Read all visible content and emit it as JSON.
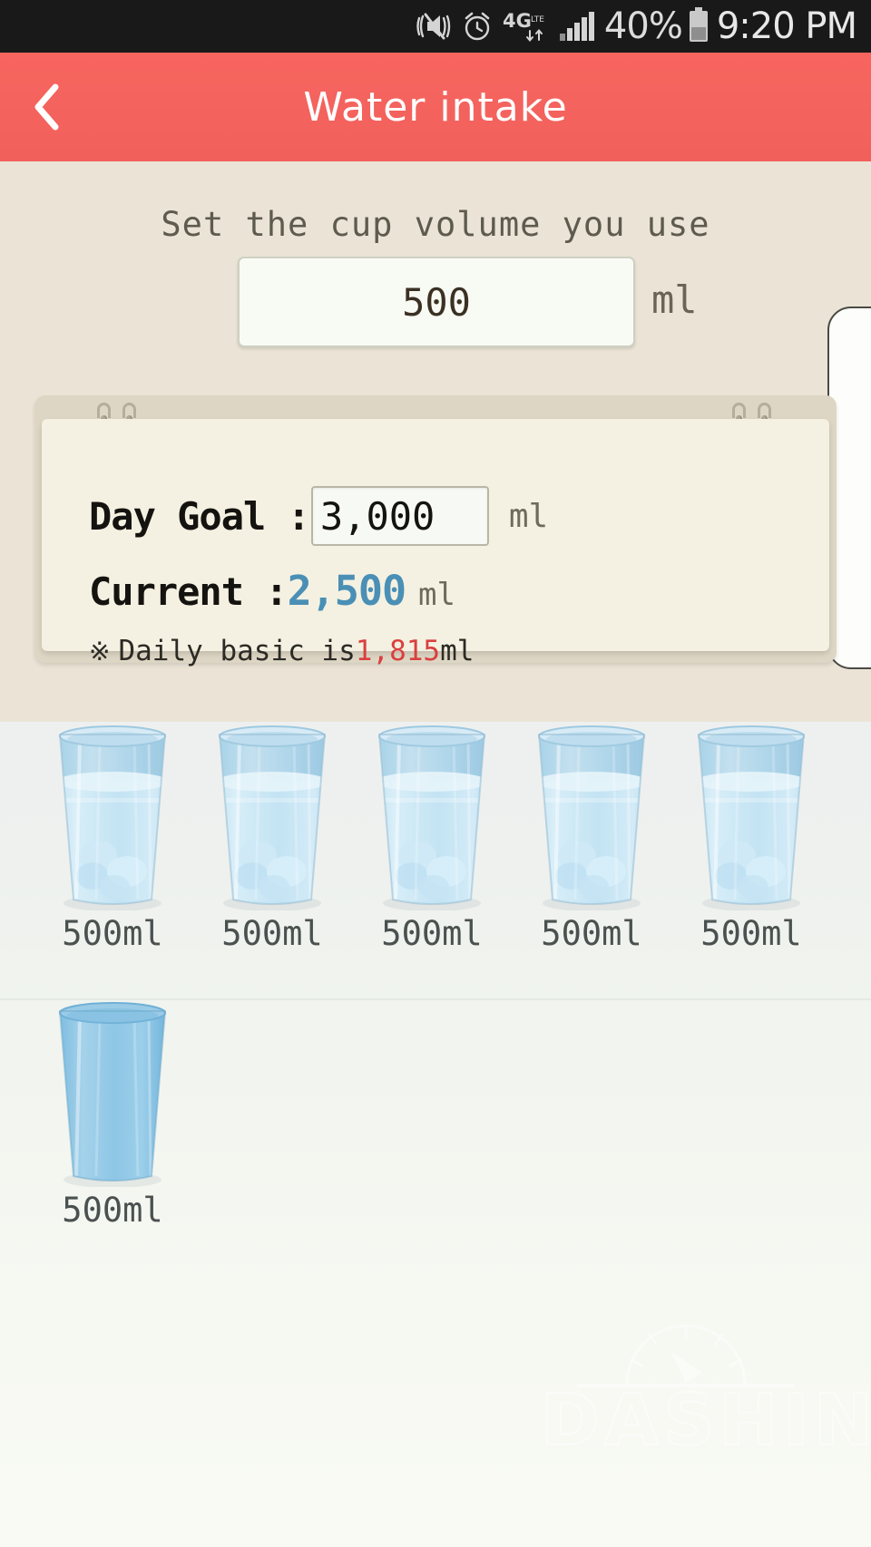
{
  "statusbar": {
    "icons": [
      "vibrate-mute-icon",
      "alarm-clock-icon",
      "4g-lte-icon",
      "signal-bars-icon"
    ],
    "network_label": "4G",
    "network_sub": "LTE",
    "battery_percent": "40%",
    "time": "9:20 PM"
  },
  "header": {
    "back_icon": "chevron-left-icon",
    "title": "Water intake",
    "color": "#f4635e"
  },
  "settings": {
    "prompt": "Set the cup volume you use",
    "cup_volume_value": "500",
    "cup_volume_placeholder": "500",
    "cup_volume_unit": "ml"
  },
  "goal_card": {
    "day_goal_label": "Day Goal :",
    "day_goal_value": "3,000",
    "day_goal_placeholder": "3,000",
    "day_goal_unit": "ml",
    "current_label": "Current :",
    "current_value": "2,500",
    "current_unit": "ml",
    "current_color": "#4a8fb5",
    "basic_star": "※",
    "basic_text": "Daily basic is",
    "basic_value": "1,815",
    "basic_unit": "ml",
    "basic_value_color": "#d9403f"
  },
  "glasses": {
    "row1": [
      {
        "label": "500ml",
        "state": "filled"
      },
      {
        "label": "500ml",
        "state": "filled"
      },
      {
        "label": "500ml",
        "state": "filled"
      },
      {
        "label": "500ml",
        "state": "filled"
      },
      {
        "label": "500ml",
        "state": "filled"
      }
    ],
    "row2": [
      {
        "label": "500ml",
        "state": "empty"
      }
    ]
  },
  "watermark": {
    "text": "DASHIN",
    "icon": "gauge-icon"
  }
}
